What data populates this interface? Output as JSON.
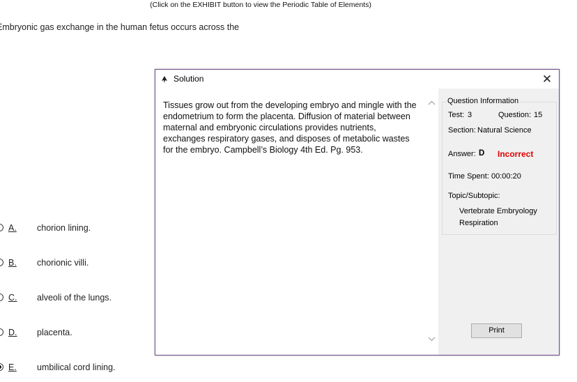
{
  "header": {
    "exhibit_note": "(Click on the EXHIBIT button to view the Periodic Table of Elements)",
    "question": "Embryonic gas exchange in the human fetus occurs across the"
  },
  "options": [
    {
      "letter": "A.",
      "text": "chorion lining.",
      "selected": false
    },
    {
      "letter": "B.",
      "text": "chorionic villi.",
      "selected": false
    },
    {
      "letter": "C.",
      "text": "alveoli of the lungs.",
      "selected": false
    },
    {
      "letter": "D.",
      "text": "placenta.",
      "selected": false
    },
    {
      "letter": "E.",
      "text": "umbilical cord lining.",
      "selected": true
    }
  ],
  "dialog": {
    "title": "Solution",
    "close_glyph": "✕",
    "solution_text": "Tissues grow out from the developing embryo and mingle with the endometrium to form the placenta. Diffusion of material between maternal and embryonic circulations provides nutrients, exchanges respiratory gases, and disposes of metabolic wastes for the embryo. Campbell’s Biology 4th Ed. Pg. 953.",
    "info": {
      "legend": "Question Information",
      "test_label": "Test:",
      "test_value": "3",
      "question_label": "Question:",
      "question_value": "15",
      "section_label": "Section:",
      "section_value": "Natural Science",
      "answer_label": "Answer:",
      "answer_value": "D",
      "result": "Incorrect",
      "time_label": "Time Spent:",
      "time_value": "00:00:20",
      "topic_label": "Topic/Subtopic:",
      "topic": "Vertebrate Embryology",
      "subtopic": "Respiration"
    },
    "print_label": "Print"
  },
  "colors": {
    "incorrect": "#e00000",
    "dialog_border": "#6b4a8c",
    "panel_bg": "#f0f0f0"
  }
}
